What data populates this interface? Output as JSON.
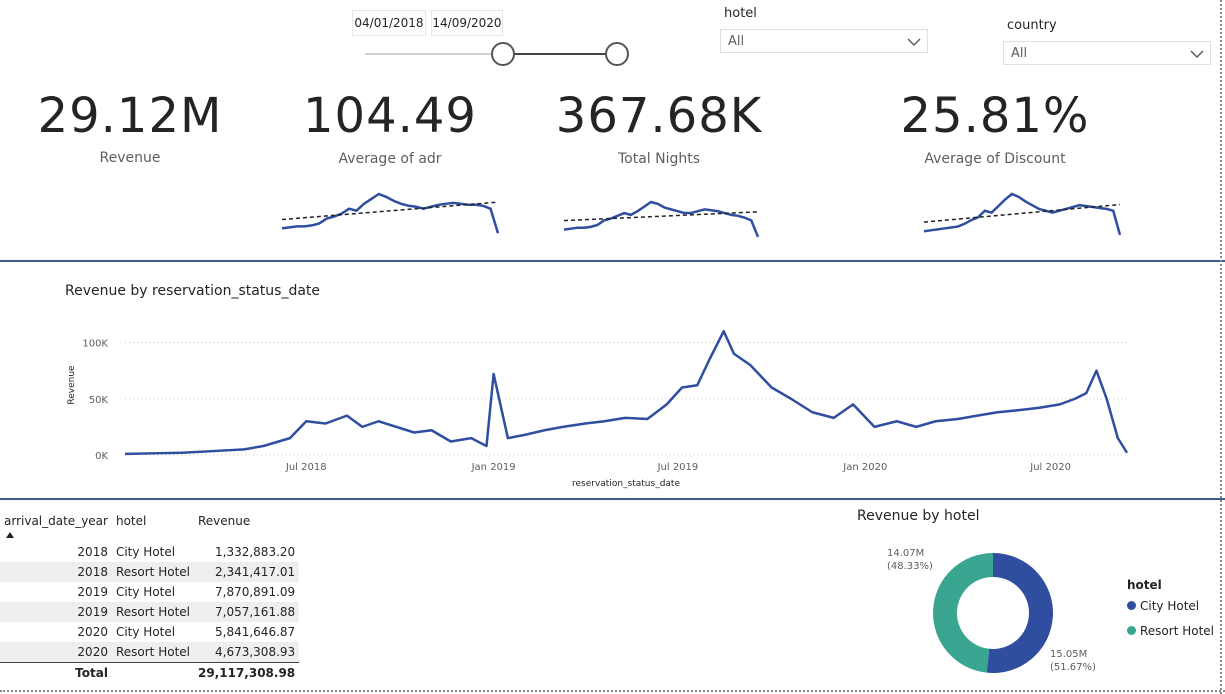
{
  "date_slicer": {
    "start": "04/01/2018",
    "end": "14/09/2020"
  },
  "hotel_slicer": {
    "title": "hotel",
    "value": "All"
  },
  "country_slicer": {
    "title": "country",
    "value": "All"
  },
  "kpis": [
    {
      "value": "29.12M",
      "label": "Revenue"
    },
    {
      "value": "104.49",
      "label": "Average of adr"
    },
    {
      "value": "367.68K",
      "label": "Total Nights"
    },
    {
      "value": "25.81%",
      "label": "Average of Discount"
    }
  ],
  "colors": {
    "series": "#2f4ea0",
    "resort": "#3aa591",
    "divider": "#3c5a87",
    "grid": "#c8c8c8"
  },
  "chart_data": [
    {
      "type": "line",
      "title": "Revenue by reservation_status_date",
      "xlabel": "reservation_status_date",
      "ylabel": "Revenue",
      "x_ticks": [
        "Jul 2018",
        "Jan 2019",
        "Jul 2019",
        "Jan 2020",
        "Jul 2020"
      ],
      "y_ticks": [
        "0K",
        "50K",
        "100K"
      ],
      "ylim": [
        0,
        120000
      ],
      "grid": true,
      "x": [
        "2018-01-04",
        "2018-02-01",
        "2018-03-01",
        "2018-04-01",
        "2018-05-01",
        "2018-05-20",
        "2018-06-15",
        "2018-07-01",
        "2018-07-20",
        "2018-08-10",
        "2018-08-25",
        "2018-09-10",
        "2018-10-01",
        "2018-10-15",
        "2018-11-01",
        "2018-11-20",
        "2018-12-10",
        "2018-12-25",
        "2019-01-01",
        "2019-01-15",
        "2019-02-01",
        "2019-02-20",
        "2019-03-10",
        "2019-04-01",
        "2019-04-20",
        "2019-05-10",
        "2019-06-01",
        "2019-06-20",
        "2019-07-05",
        "2019-07-20",
        "2019-08-01",
        "2019-08-15",
        "2019-08-25",
        "2019-09-10",
        "2019-10-01",
        "2019-10-20",
        "2019-11-10",
        "2019-12-01",
        "2019-12-20",
        "2020-01-10",
        "2020-02-01",
        "2020-02-20",
        "2020-03-10",
        "2020-04-01",
        "2020-04-20",
        "2020-05-10",
        "2020-06-01",
        "2020-06-20",
        "2020-07-10",
        "2020-07-25",
        "2020-08-05",
        "2020-08-15",
        "2020-08-25",
        "2020-09-05",
        "2020-09-14"
      ],
      "series": [
        {
          "values": [
            1000,
            1500,
            2000,
            3500,
            5000,
            8000,
            15000,
            30000,
            28000,
            35000,
            25000,
            30000,
            24000,
            20000,
            22000,
            12000,
            15000,
            8000,
            72000,
            15000,
            18000,
            22000,
            25000,
            28000,
            30000,
            33000,
            32000,
            45000,
            60000,
            62000,
            85000,
            110000,
            90000,
            80000,
            60000,
            50000,
            38000,
            33000,
            45000,
            25000,
            30000,
            25000,
            30000,
            32000,
            35000,
            38000,
            40000,
            42000,
            45000,
            50000,
            55000,
            75000,
            50000,
            15000,
            2000
          ]
        }
      ]
    },
    {
      "type": "pie",
      "title": "Revenue by hotel",
      "legend_title": "hotel",
      "legend_position": "right",
      "categories": [
        "City Hotel",
        "Resort Hotel"
      ],
      "values": [
        15050000,
        14070000
      ],
      "labels": [
        "15.05M",
        "14.07M"
      ],
      "percent_labels": [
        "(51.67%)",
        "(48.33%)"
      ]
    }
  ],
  "sparklines": {
    "adr": [
      20,
      21,
      22,
      22,
      23,
      25,
      30,
      32,
      35,
      40,
      38,
      45,
      50,
      55,
      52,
      48,
      45,
      43,
      42,
      40,
      42,
      44,
      45,
      46,
      45,
      44,
      44,
      43,
      40,
      15
    ],
    "nights": [
      20,
      21,
      22,
      22,
      23,
      25,
      30,
      32,
      35,
      38,
      36,
      40,
      45,
      50,
      48,
      44,
      42,
      40,
      38,
      38,
      40,
      42,
      41,
      40,
      38,
      36,
      35,
      33,
      30,
      12
    ],
    "discount": [
      18,
      19,
      20,
      21,
      22,
      23,
      26,
      30,
      33,
      40,
      38,
      45,
      52,
      58,
      55,
      50,
      46,
      42,
      40,
      38,
      40,
      42,
      44,
      46,
      45,
      44,
      43,
      42,
      40,
      14
    ]
  },
  "table": {
    "headers": [
      "arrival_date_year",
      "hotel",
      "Revenue"
    ],
    "rows": [
      [
        "2018",
        "City Hotel",
        "1,332,883.20"
      ],
      [
        "2018",
        "Resort Hotel",
        "2,341,417.01"
      ],
      [
        "2019",
        "City Hotel",
        "7,870,891.09"
      ],
      [
        "2019",
        "Resort Hotel",
        "7,057,161.88"
      ],
      [
        "2020",
        "City Hotel",
        "5,841,646.87"
      ],
      [
        "2020",
        "Resort Hotel",
        "4,673,308.93"
      ]
    ],
    "total_label": "Total",
    "total_value": "29,117,308.98"
  }
}
